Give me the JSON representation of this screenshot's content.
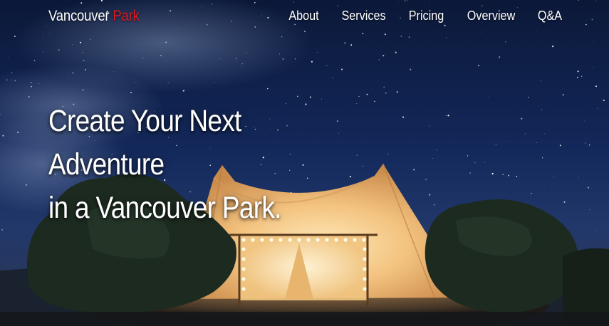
{
  "brand": {
    "name_part1": "Vancouver",
    "name_part2": "Park",
    "accent_color": "#e0191e"
  },
  "nav": {
    "items": [
      {
        "label": "About"
      },
      {
        "label": "Services"
      },
      {
        "label": "Pricing"
      },
      {
        "label": "Overview"
      },
      {
        "label": "Q&A"
      }
    ]
  },
  "hero": {
    "headline_lines": [
      "Create Your Next",
      "Adventure",
      "in a Vancouver Park."
    ],
    "background_icon": "glamping-tent-night-sky-photo"
  }
}
